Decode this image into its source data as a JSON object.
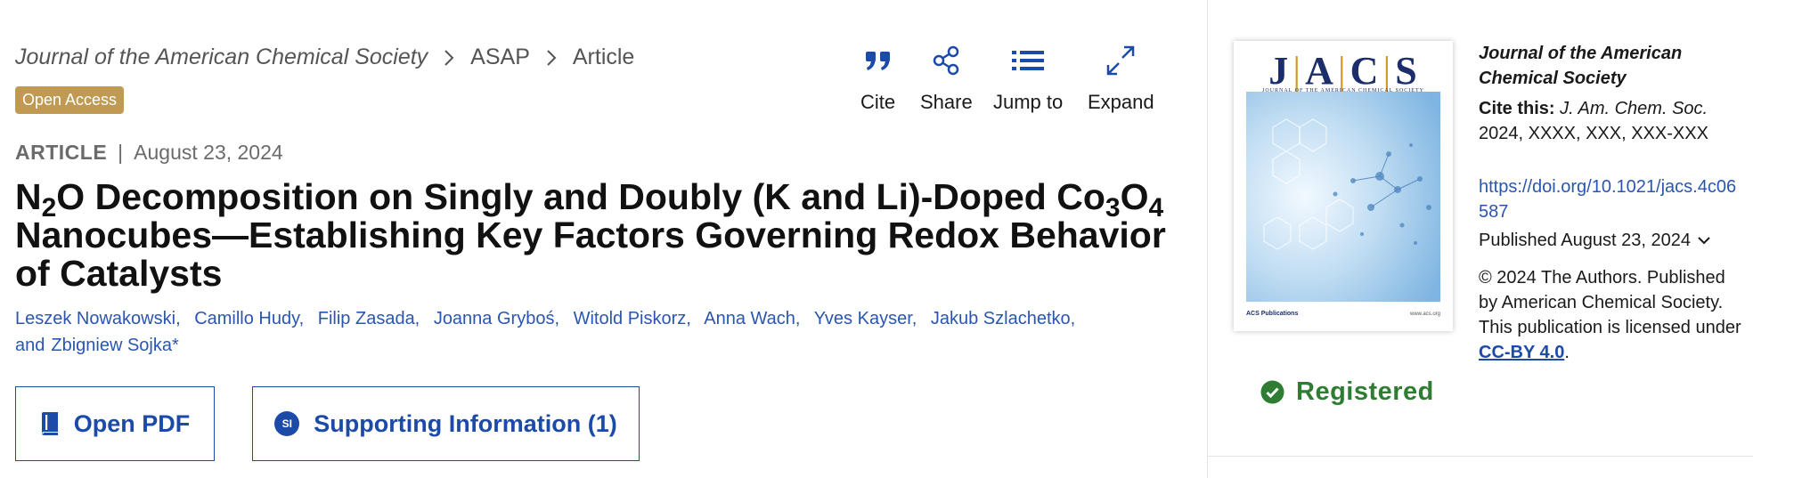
{
  "breadcrumb": {
    "journal": "Journal of the American Chemical Society",
    "section": "ASAP",
    "page": "Article"
  },
  "badge": {
    "open_access": "Open Access"
  },
  "toolbar": {
    "cite": "Cite",
    "share": "Share",
    "jump_to": "Jump to",
    "expand": "Expand"
  },
  "article": {
    "type": "ARTICLE",
    "date": "August 23, 2024",
    "title": {
      "line1_part1": "N",
      "line1_sub1": "2",
      "line1_part2": "O Decomposition on Singly and Doubly (K and Li)-Doped Co",
      "line1_sub2": "3",
      "line1_part3": "O",
      "line1_sub3": "4",
      "rest": "Nanocubes—Establishing Key Factors Governing Redox Behavior of Catalysts"
    },
    "authors": [
      "Leszek Nowakowski,",
      "Camillo Hudy,",
      "Filip Zasada,",
      "Joanna Gryboś,",
      "Witold Piskorz,",
      "Anna Wach,",
      "Yves Kayser,",
      "Jakub Szlachetko,",
      "and",
      "Zbigniew Sojka*"
    ]
  },
  "buttons": {
    "open_pdf": "Open PDF",
    "supporting_info": "Supporting Information (1)",
    "si_badge": "SI"
  },
  "cover": {
    "masthead_letters": [
      "J",
      "A",
      "C",
      "S"
    ],
    "subtitle": "JOURNAL OF THE AMERICAN CHEMICAL SOCIETY",
    "publisher": "ACS Publications",
    "url": "www.acs.org"
  },
  "sidebar": {
    "journal_name": "Journal of the American Chemical Society",
    "cite_label": "Cite this:",
    "cite_journal": "J. Am. Chem. Soc.",
    "cite_details": "2024, XXXX, XXX, XXX-XXX",
    "doi": "https://doi.org/10.1021/jacs.4c06587",
    "published": "Published August 23, 2024",
    "copyright": "© 2024 The Authors. Published by American Chemical Society. This publication is licensed under",
    "license": "CC-BY 4.0",
    "copyright_end": "."
  },
  "registered": "Registered",
  "colors": {
    "link": "#2a56b0",
    "button": "#1b4aa8",
    "open_access": "#c09a52",
    "registered": "#2f7d32"
  },
  "icons": {
    "cite": "quote-icon",
    "share": "share-icon",
    "jump_to": "list-icon",
    "expand": "expand-icon",
    "pdf": "book-icon",
    "registered": "check-circle-icon"
  }
}
